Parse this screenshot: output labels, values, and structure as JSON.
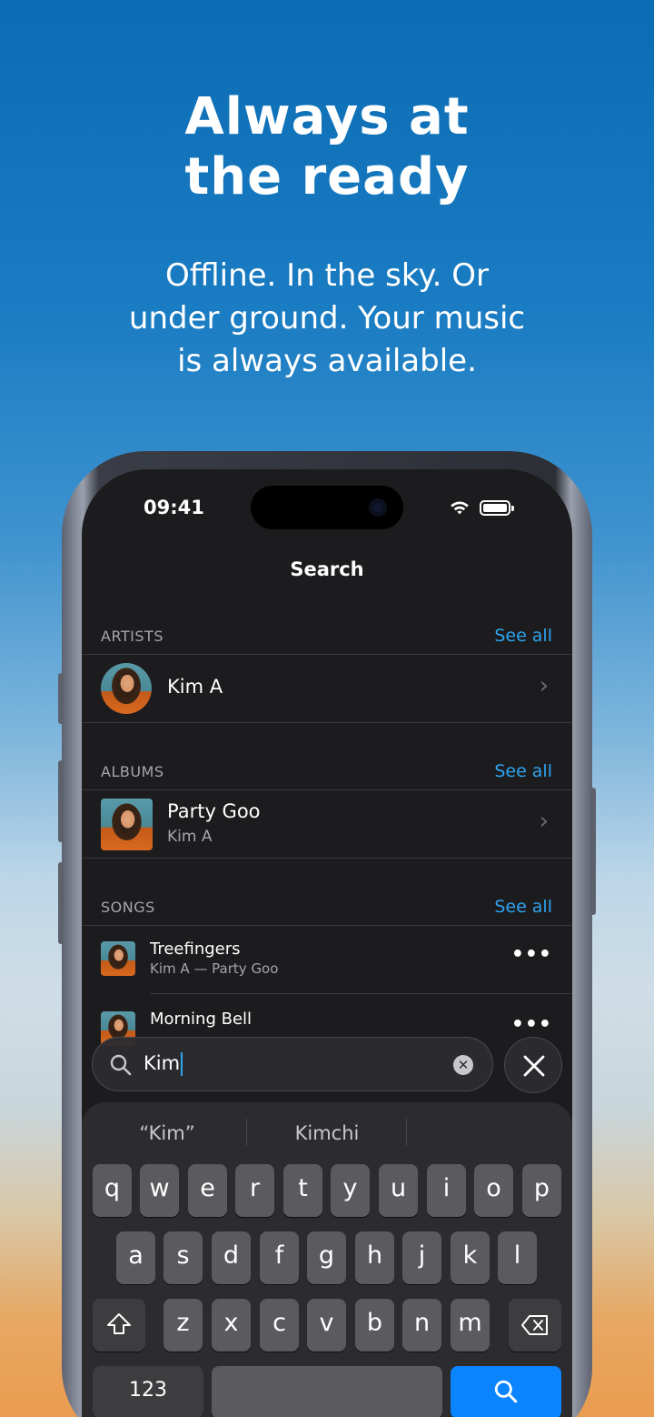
{
  "promo": {
    "headline": [
      "Always at",
      "the ready"
    ],
    "subline": [
      "Offline. In the sky. Or",
      "under ground. Your music",
      "is always available."
    ]
  },
  "status_bar": {
    "time": "09:41"
  },
  "screen_title": "Search",
  "artists": {
    "label": "ARTISTS",
    "see_all": "See all",
    "items": [
      {
        "name": "Kim A"
      }
    ]
  },
  "albums": {
    "label": "ALBUMS",
    "see_all": "See all",
    "items": [
      {
        "title": "Party Goo",
        "artist": "Kim A"
      }
    ]
  },
  "songs": {
    "label": "SONGS",
    "see_all": "See all",
    "items": [
      {
        "title": "Treefingers",
        "subtitle": "Kim A — Party Goo"
      },
      {
        "title": "Morning Bell",
        "subtitle": ""
      }
    ]
  },
  "search": {
    "query": "Kim",
    "clear_icon": "clear-icon",
    "close_icon": "close-icon"
  },
  "keyboard": {
    "suggestions": [
      "“Kim”",
      "Kimchi",
      ""
    ],
    "row1": [
      "q",
      "w",
      "e",
      "r",
      "t",
      "y",
      "u",
      "i",
      "o",
      "p"
    ],
    "row2": [
      "a",
      "s",
      "d",
      "f",
      "g",
      "h",
      "j",
      "k",
      "l"
    ],
    "row3": [
      "z",
      "x",
      "c",
      "v",
      "b",
      "n",
      "m"
    ],
    "numbers_key": "123",
    "accent_color": "#0a84ff"
  }
}
